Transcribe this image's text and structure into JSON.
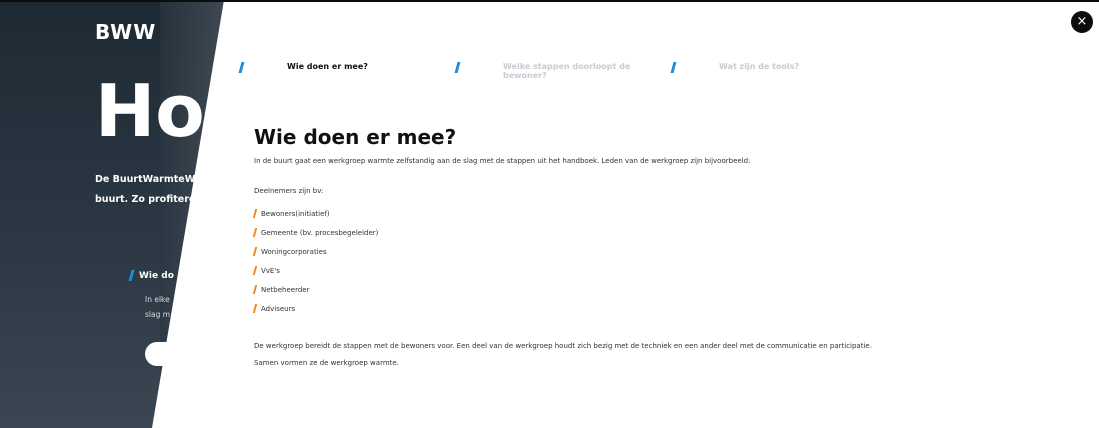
{
  "hero": {
    "logo": "BWW",
    "title": "Hoe",
    "intro_line1": "De BuurtWarmteWijz",
    "intro_line2": "buurt. Zo profiteren",
    "subheading": "Wie do",
    "subtext_line1": "In elke",
    "subtext_line2": "slag m"
  },
  "close_icon": "×",
  "tabs": [
    {
      "label": "Wie doen er mee?",
      "active": true
    },
    {
      "label": "Welke stappen doorloopt de bewoner?",
      "active": false
    },
    {
      "label": "Wat zijn de tools?",
      "active": false
    }
  ],
  "content": {
    "title": "Wie doen er mee?",
    "lead": "In de buurt gaat een werkgroep warmte zelfstandig aan de slag met de stappen uit het handboek. Leden van de werkgroep zijn bijvoorbeeld:",
    "list_intro": "Deelnemers zijn bv:",
    "items": [
      "Bewoners(initiatief)",
      "Gemeente (bv. procesbegeleider)",
      "Woningcorporaties",
      "VvE's",
      "Netbeheerder",
      "Adviseurs"
    ],
    "bottom": "De werkgroep bereidt de stappen met de bewoners voor. Een deel van de werkgroep houdt zich bezig met de techniek en een ander deel met de communicatie en participatie. Samen vormen ze de werkgroep warmte."
  },
  "colors": {
    "accent_blue": "#1e8ed8",
    "accent_orange": "#f08a1e",
    "dark": "#0d0d0d"
  }
}
